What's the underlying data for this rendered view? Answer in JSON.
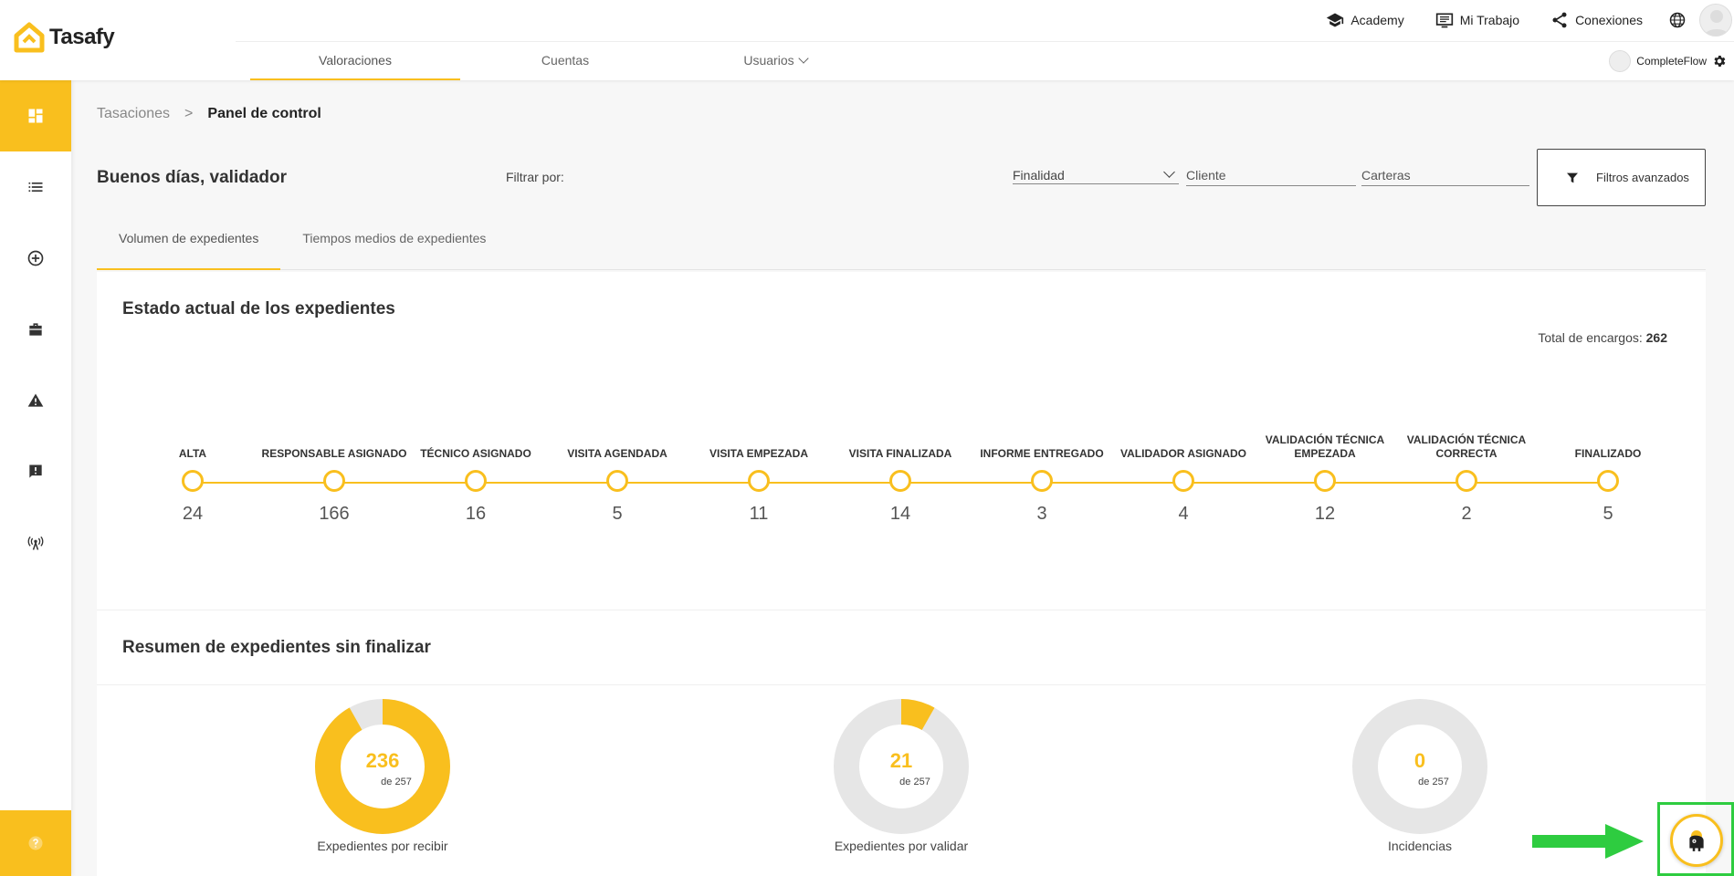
{
  "app": {
    "name": "Tasafy"
  },
  "topnav": {
    "academy": "Academy",
    "mi_trabajo": "Mi Trabajo",
    "conexiones": "Conexiones"
  },
  "subnav": {
    "tabs": [
      {
        "label": "Valoraciones",
        "active": true
      },
      {
        "label": "Cuentas",
        "active": false
      },
      {
        "label": "Usuarios",
        "active": false
      }
    ]
  },
  "user": {
    "name": "CompleteFlow"
  },
  "sidebar": {
    "items": [
      {
        "icon": "dashboard-icon",
        "active": true
      },
      {
        "icon": "list-icon",
        "active": false
      },
      {
        "icon": "add-circle-icon",
        "active": false
      },
      {
        "icon": "briefcase-icon",
        "active": false
      },
      {
        "icon": "warning-icon",
        "active": false
      },
      {
        "icon": "feedback-icon",
        "active": false
      },
      {
        "icon": "antenna-icon",
        "active": false
      }
    ],
    "help_icon": "help-icon"
  },
  "breadcrumb": {
    "parent": "Tasaciones",
    "separator": ">",
    "current": "Panel de control"
  },
  "greeting": "Buenos días, validador",
  "filters": {
    "label": "Filtrar por:",
    "finalidad": "Finalidad",
    "cliente_placeholder": "Cliente",
    "carteras_placeholder": "Carteras",
    "advanced_label": "Filtros avanzados"
  },
  "tabs": [
    {
      "label": "Volumen de expedientes",
      "active": true
    },
    {
      "label": "Tiempos medios de expedientes",
      "active": false
    }
  ],
  "estado": {
    "title": "Estado actual de los expedientes",
    "total_label": "Total de encargos:",
    "total_value": "262",
    "stages": [
      {
        "label": "ALTA",
        "count": "24"
      },
      {
        "label": "RESPONSABLE ASIGNADO",
        "count": "166"
      },
      {
        "label": "TÉCNICO ASIGNADO",
        "count": "16"
      },
      {
        "label": "VISITA AGENDADA",
        "count": "5"
      },
      {
        "label": "VISITA EMPEZADA",
        "count": "11"
      },
      {
        "label": "VISITA FINALIZADA",
        "count": "14"
      },
      {
        "label": "INFORME ENTREGADO",
        "count": "3"
      },
      {
        "label": "VALIDADOR ASIGNADO",
        "count": "4"
      },
      {
        "label": "VALIDACIÓN TÉCNICA EMPEZADA",
        "count": "12"
      },
      {
        "label": "VALIDACIÓN TÉCNICA CORRECTA",
        "count": "2"
      },
      {
        "label": "FINALIZADO",
        "count": "5"
      }
    ]
  },
  "resumen": {
    "title": "Resumen de expedientes sin finalizar",
    "donuts": [
      {
        "value": "236",
        "of": "de 257",
        "label": "Expedientes por recibir",
        "fraction": 0.918
      },
      {
        "value": "21",
        "of": "de 257",
        "label": "Expedientes por validar",
        "fraction": 0.082
      },
      {
        "value": "0",
        "of": "de 257",
        "label": "Incidencias",
        "fraction": 0
      }
    ]
  },
  "colors": {
    "accent": "#f9bf1e",
    "track": "#e6e6e6",
    "highlight": "#2ecc40"
  }
}
